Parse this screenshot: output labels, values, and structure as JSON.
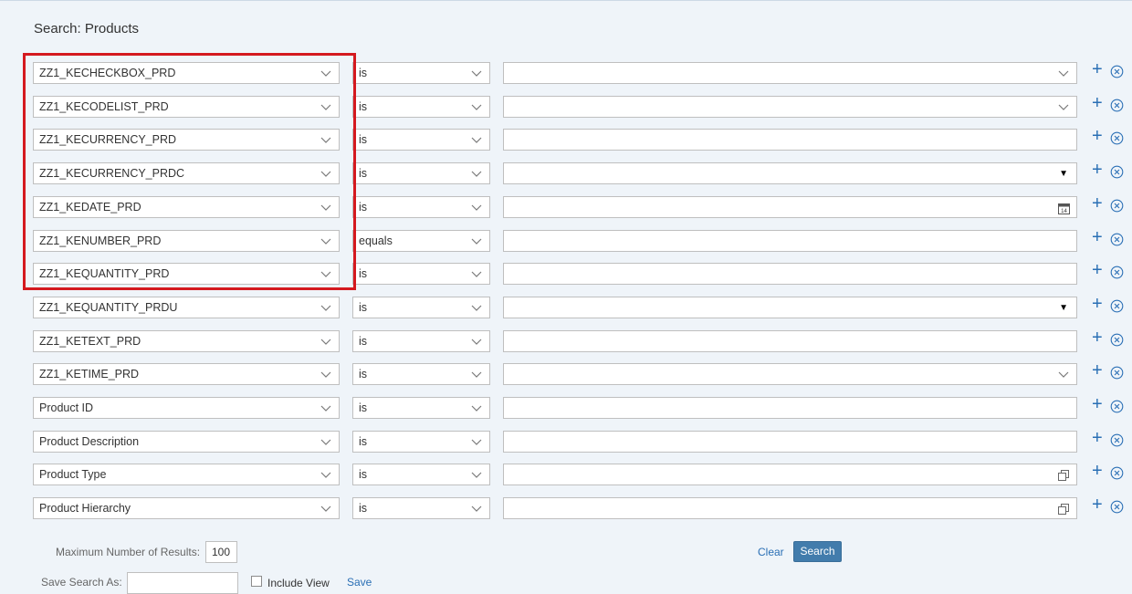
{
  "page": {
    "title": "Search: Products"
  },
  "rows": [
    {
      "field": "ZZ1_KECHECKBOX_PRD",
      "operator": "is",
      "value": "",
      "value_icon": "chevron-down-icon"
    },
    {
      "field": "ZZ1_KECODELIST_PRD",
      "operator": "is",
      "value": "",
      "value_icon": "chevron-down-icon"
    },
    {
      "field": "ZZ1_KECURRENCY_PRD",
      "operator": "is",
      "value": "",
      "value_icon": ""
    },
    {
      "field": "ZZ1_KECURRENCY_PRDC",
      "operator": "is",
      "value": "",
      "value_icon": "caret-down-icon"
    },
    {
      "field": "ZZ1_KEDATE_PRD",
      "operator": "is",
      "value": "",
      "value_icon": "calendar-icon"
    },
    {
      "field": "ZZ1_KENUMBER_PRD",
      "operator": "equals",
      "value": "",
      "value_icon": ""
    },
    {
      "field": "ZZ1_KEQUANTITY_PRD",
      "operator": "is",
      "value": "",
      "value_icon": ""
    },
    {
      "field": "ZZ1_KEQUANTITY_PRDU",
      "operator": "is",
      "value": "",
      "value_icon": "caret-down-icon"
    },
    {
      "field": "ZZ1_KETEXT_PRD",
      "operator": "is",
      "value": "",
      "value_icon": ""
    },
    {
      "field": "ZZ1_KETIME_PRD",
      "operator": "is",
      "value": "",
      "value_icon": "chevron-down-icon"
    },
    {
      "field": "Product ID",
      "operator": "is",
      "value": "",
      "value_icon": ""
    },
    {
      "field": "Product Description",
      "operator": "is",
      "value": "",
      "value_icon": ""
    },
    {
      "field": "Product Type",
      "operator": "is",
      "value": "",
      "value_icon": "value-help-icon"
    },
    {
      "field": "Product Hierarchy",
      "operator": "is",
      "value": "",
      "value_icon": "value-help-icon"
    }
  ],
  "footer": {
    "max_results_label": "Maximum Number of Results:",
    "max_results_value": "100",
    "save_search_label": "Save Search As:",
    "save_search_value": "",
    "include_view_label": "Include View",
    "save_label": "Save",
    "clear_label": "Clear",
    "search_label": "Search"
  },
  "colors": {
    "accent": "#2a6fb5",
    "button": "#427cac",
    "highlight": "#d4191f",
    "background": "#eff4f9"
  }
}
